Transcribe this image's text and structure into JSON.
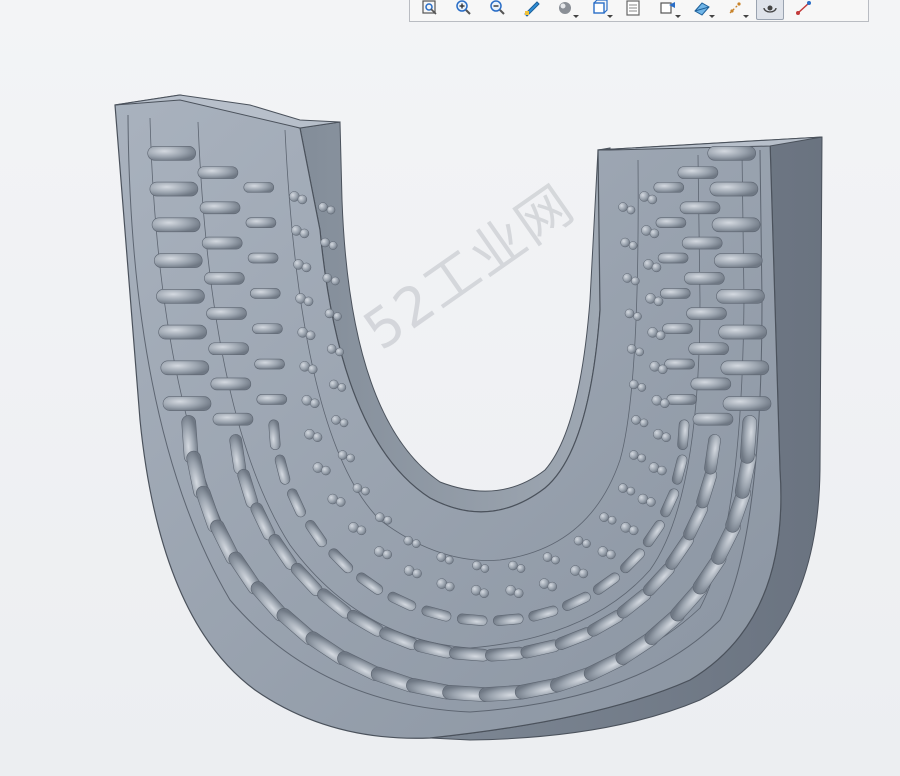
{
  "toolbar": {
    "buttons": [
      {
        "icon": "refit-icon",
        "caret": false,
        "active": false
      },
      {
        "icon": "zoom-in-icon",
        "caret": false,
        "active": false
      },
      {
        "icon": "zoom-out-icon",
        "caret": false,
        "active": false
      },
      {
        "icon": "repaint-icon",
        "caret": false,
        "active": false
      },
      {
        "icon": "display-style-icon",
        "caret": true,
        "active": false
      },
      {
        "icon": "saved-orientations-icon",
        "caret": true,
        "active": false
      },
      {
        "icon": "view-manager-icon",
        "caret": false,
        "active": false
      },
      {
        "icon": "perspective-view-icon",
        "caret": true,
        "active": false
      },
      {
        "icon": "section-icon",
        "caret": true,
        "active": false
      },
      {
        "icon": "datum-display-icon",
        "caret": true,
        "active": false
      },
      {
        "icon": "spin-center-icon",
        "caret": false,
        "active": true
      },
      {
        "icon": "annotation-display-icon",
        "caret": false,
        "active": false
      }
    ]
  },
  "watermark": {
    "text": "52工业网"
  },
  "colors": {
    "model": "#9aa4b0",
    "model_dark": "#6c7683",
    "background": "#eef0f3"
  }
}
